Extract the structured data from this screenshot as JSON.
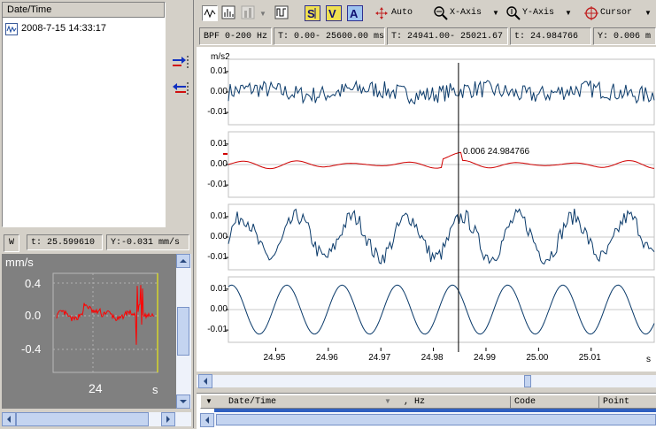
{
  "left_list": {
    "header": "Date/Time",
    "items": [
      "2008-7-15 14:33:17"
    ]
  },
  "side_buttons": [
    "add-channel-icon",
    "remove-channel-icon"
  ],
  "mini": {
    "status_t": "t: 25.599610",
    "status_y": "Y:-0.031 mm/s",
    "unit": "mm/s",
    "ylabels": [
      "0.4",
      "0.0",
      "-0.4"
    ],
    "xlabel": "24",
    "xunit": "s"
  },
  "toolbar": {
    "auto": "Auto",
    "xaxis": "X-Axis",
    "yaxis": "Y-Axis",
    "cursor": "Cursor",
    "icons": [
      "waveform-icon",
      "spectrum-icon",
      "bargraph-icon",
      "filter-icon",
      "scale-all-icon",
      "scale-y-icon",
      "autoscale-icon"
    ]
  },
  "infobar": {
    "filter": "BPF 0-200 Hz",
    "range": "T: 0.00- 25600.00 ms",
    "view": "T: 24941.00- 25021.67",
    "t": "t: 24.984766",
    "y": "Y:  0.006 m"
  },
  "plot": {
    "unit": "m/s2",
    "cursor_label": "0.006  24.984766",
    "x_unit": "s",
    "accent": "#d00000",
    "trace_color": "#0a3a6a"
  },
  "chart_data": {
    "type": "line",
    "xlim": [
      24.941,
      25.022
    ],
    "x_ticks": [
      "24.95",
      "24.96",
      "24.97",
      "24.98",
      "24.99",
      "25.00",
      "25.01"
    ],
    "y_ticks": [
      "0.01",
      "0.00",
      "-0.01"
    ],
    "cursor_x": 24.984766,
    "cursor_y": 0.006,
    "series": [
      {
        "color": "#0a3a6a",
        "kind": "noise",
        "amplitude": 0.004
      },
      {
        "color": "#d00000",
        "kind": "low-frequency",
        "amplitude": 0.0025
      },
      {
        "color": "#0a3a6a",
        "kind": "noisy sine",
        "amplitude": 0.01
      },
      {
        "color": "#0a3a6a",
        "kind": "sine",
        "amplitude": 0.012
      }
    ]
  },
  "grid": {
    "columns": [
      "Date/Time",
      ", Hz",
      "Code",
      "Point"
    ]
  }
}
